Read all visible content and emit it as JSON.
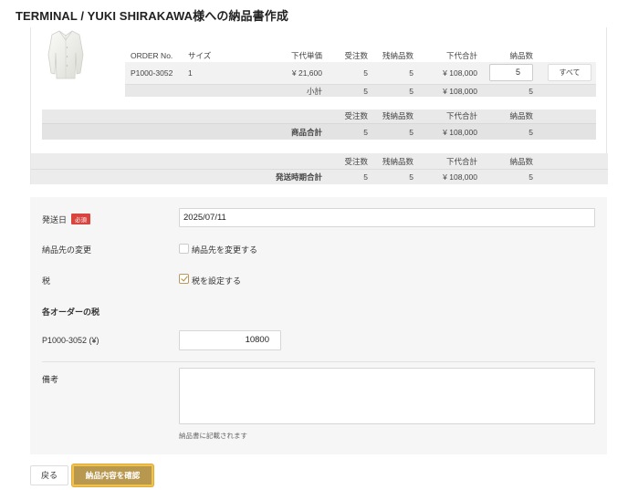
{
  "page": {
    "title": "TERMINAL / YUKI SHIRAKAWA様への納品書作成"
  },
  "line_table": {
    "headers": {
      "order_no": "ORDER No.",
      "size": "サイズ",
      "unit_price": "下代単価",
      "ordered": "受注数",
      "remaining": "残納品数",
      "subtotal_price": "下代合計",
      "delivery_qty": "納品数"
    },
    "item": {
      "order_no": "P1000-3052",
      "size": "1",
      "unit_price": "¥ 21,600",
      "ordered": "5",
      "remaining": "5",
      "subtotal_price": "¥ 108,000",
      "delivery_qty": "5",
      "all_button": "すべて"
    },
    "subtotal": {
      "label": "小計",
      "ordered": "5",
      "remaining": "5",
      "subtotal_price": "¥ 108,000",
      "delivery_qty": "5"
    }
  },
  "product_total": {
    "headers": {
      "ordered": "受注数",
      "remaining": "残納品数",
      "subtotal_price": "下代合計",
      "delivery_qty": "納品数"
    },
    "label": "商品合計",
    "ordered": "5",
    "remaining": "5",
    "subtotal_price": "¥ 108,000",
    "delivery_qty": "5"
  },
  "shipping_total": {
    "headers": {
      "ordered": "受注数",
      "remaining": "残納品数",
      "subtotal_price": "下代合計",
      "delivery_qty": "納品数"
    },
    "label": "発送時期合計",
    "ordered": "5",
    "remaining": "5",
    "subtotal_price": "¥ 108,000",
    "delivery_qty": "5"
  },
  "form": {
    "ship_date": {
      "label": "発送日",
      "required_badge": "必須",
      "value": "2025/07/11"
    },
    "change_destination": {
      "label": "納品先の変更",
      "checkbox_label": "納品先を変更する",
      "checked": false
    },
    "tax": {
      "label": "税",
      "checkbox_label": "税を設定する",
      "checked": true
    },
    "order_tax": {
      "section_title": "各オーダーの税",
      "order_label": "P1000-3052 (¥)",
      "value": "10800"
    },
    "notes": {
      "label": "備考",
      "value": "",
      "hint": "納品書に記載されます"
    }
  },
  "footer": {
    "back_label": "戻る",
    "confirm_label": "納品内容を確認"
  },
  "colors": {
    "accent": "#b8974e",
    "focus_ring": "#f1c24a",
    "required": "#d9443e"
  },
  "icons": {
    "product": "jacket-thumbnail",
    "checkbox": "checkmark-icon"
  }
}
